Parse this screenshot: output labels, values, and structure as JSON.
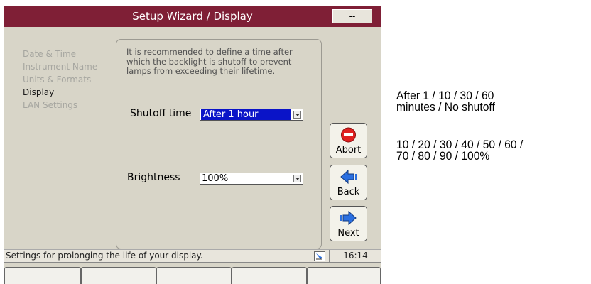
{
  "window": {
    "title": "Setup Wizard / Display",
    "title_button": "--"
  },
  "steps": [
    {
      "label": "Date & Time",
      "active": false
    },
    {
      "label": "Instrument Name",
      "active": false
    },
    {
      "label": "Units & Formats",
      "active": false
    },
    {
      "label": "Display",
      "active": true
    },
    {
      "label": "LAN Settings",
      "active": false
    }
  ],
  "panel": {
    "description": "It is recommended to define a time after which the backlight is shutoff to prevent lamps from exceeding their lifetime.",
    "shutoff": {
      "label": "Shutoff time",
      "value": "After 1 hour"
    },
    "brightness": {
      "label": "Brightness",
      "value": "100%"
    }
  },
  "buttons": {
    "abort": "Abort",
    "back": "Back",
    "next": "Next"
  },
  "status": {
    "text": "Settings for prolonging the life of your display.",
    "time": "16:14"
  },
  "annotations": {
    "shutoff_options_line1": "After 1 / 10 / 30 / 60",
    "shutoff_options_line2": "minutes / No shutoff",
    "brightness_options_line1": "10 / 20 / 30 / 40 / 50 / 60 /",
    "brightness_options_line2": "70 / 80 / 90 / 100%"
  },
  "icons": {
    "abort": "stop-icon",
    "back": "left-arrow-icon",
    "next": "right-arrow-icon",
    "status": "pen-note-icon"
  },
  "colors": {
    "title_bar": "#7f1f36",
    "selection": "#0a14c8",
    "abort_icon": "#e02020",
    "arrow_icon": "#2a6fe0"
  }
}
